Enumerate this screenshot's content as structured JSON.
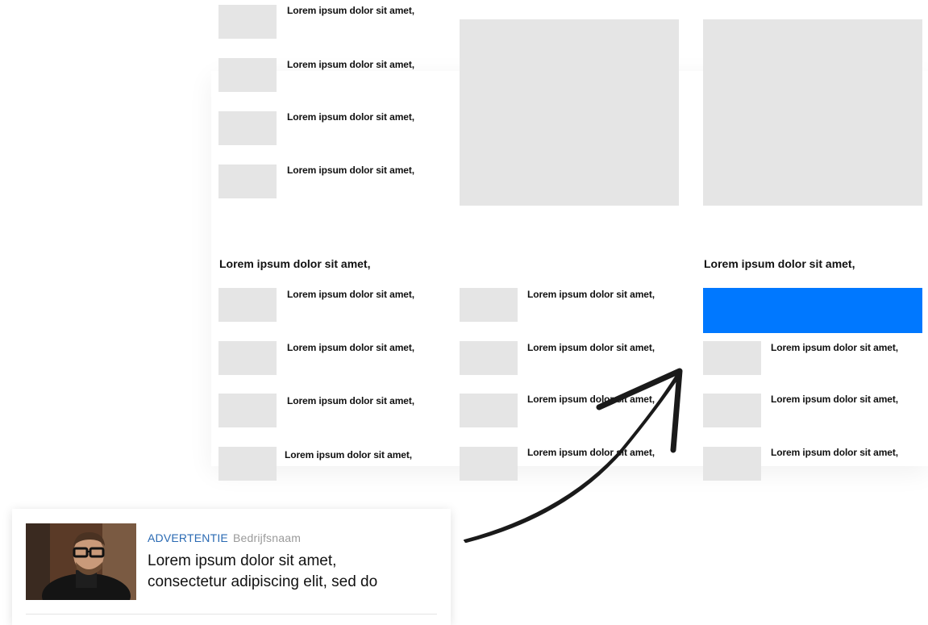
{
  "item_label": "Lorem ipsum dolor sit amet,",
  "sections": {
    "left_heading": "Lorem ipsum dolor sit amet,",
    "right_heading": "Lorem ipsum dolor sit amet,"
  },
  "ad": {
    "kind": "ADVERTENTIE",
    "company": "Bedrijfsnaam",
    "title_line1": "Lorem ipsum dolor sit amet,",
    "title_line2": "consectetur adipiscing elit, sed do"
  },
  "colors": {
    "placeholder": "#e5e5e5",
    "ad_slot": "#0078ff",
    "ad_label": "#2a6ab3",
    "company": "#9a9a9a",
    "arrow": "#1a1a1a"
  },
  "icons": {
    "arrow": "curved-arrow-icon",
    "ad_image": "person-photo"
  }
}
